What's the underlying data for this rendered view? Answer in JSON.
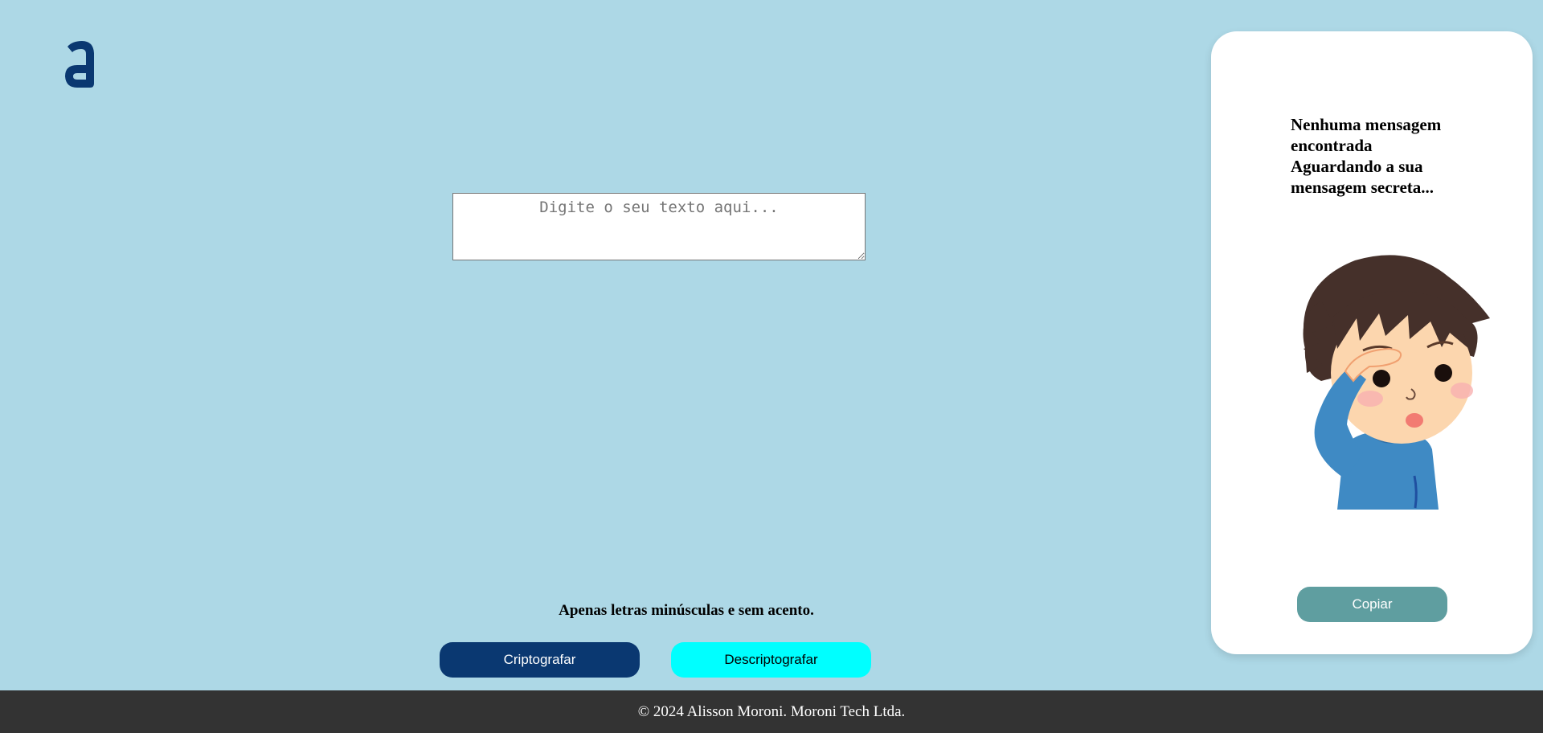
{
  "logo": {
    "icon": "alura-a-logo-icon",
    "color": "#0a3871"
  },
  "input": {
    "placeholder": "Digite o seu texto aqui...",
    "value": ""
  },
  "hint": "Apenas letras minúsculas e sem acento.",
  "buttons": {
    "encrypt": "Criptografar",
    "decrypt": "Descriptografar"
  },
  "panel": {
    "lines": [
      "Nenhuma mensagem",
      "encontrada",
      "Aguardando a sua",
      "mensagem secreta..."
    ],
    "illustration": "searching-boy-illustration",
    "copy_label": "Copiar"
  },
  "footer": "© 2024 Alisson Moroni. Moroni Tech Ltda.",
  "colors": {
    "background": "#add8e6",
    "primary": "#0a3871",
    "secondary": "#00ffff",
    "copy": "#5f9ea0",
    "footer": "#333333"
  }
}
